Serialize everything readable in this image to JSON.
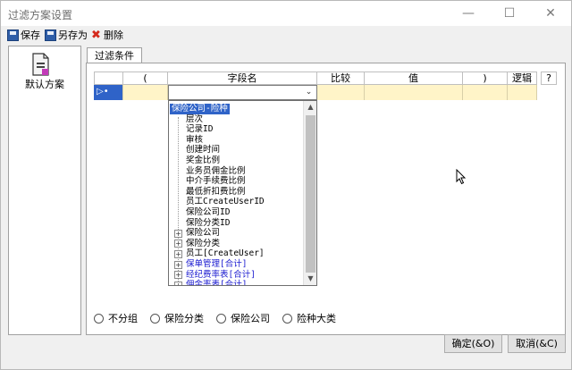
{
  "window": {
    "title": "过滤方案设置",
    "minimize_glyph": "—",
    "maximize_glyph": "☐",
    "close_glyph": "✕"
  },
  "toolbar": {
    "save_label": "保存",
    "saveas_label": "另存为",
    "delete_label": "删除",
    "save_icon": "save-icon",
    "saveas_icon": "save-as-icon",
    "delete_icon": "delete-x-icon"
  },
  "schemes": {
    "items": [
      {
        "label": "默认方案",
        "icon": "document-icon"
      }
    ]
  },
  "tab": {
    "label": "过滤条件"
  },
  "grid": {
    "columns": [
      "(",
      "字段名",
      "比较",
      "值",
      ")",
      "逻辑"
    ],
    "help_button": "?",
    "row_marker": "▷•"
  },
  "combo": {
    "value": "",
    "arrow": "⌄"
  },
  "dropdown": {
    "items": [
      {
        "label": "保险公司-险种",
        "selected": true,
        "expandable": false,
        "blue": false,
        "level": 0
      },
      {
        "label": "层次",
        "selected": false,
        "expandable": false,
        "blue": false,
        "level": 1
      },
      {
        "label": "记录ID",
        "selected": false,
        "expandable": false,
        "blue": false,
        "level": 1
      },
      {
        "label": "审核",
        "selected": false,
        "expandable": false,
        "blue": false,
        "level": 1
      },
      {
        "label": "创建时间",
        "selected": false,
        "expandable": false,
        "blue": false,
        "level": 1
      },
      {
        "label": "奖金比例",
        "selected": false,
        "expandable": false,
        "blue": false,
        "level": 1
      },
      {
        "label": "业务员佣金比例",
        "selected": false,
        "expandable": false,
        "blue": false,
        "level": 1
      },
      {
        "label": "中介手续费比例",
        "selected": false,
        "expandable": false,
        "blue": false,
        "level": 1
      },
      {
        "label": "最低折扣费比例",
        "selected": false,
        "expandable": false,
        "blue": false,
        "level": 1
      },
      {
        "label": "员工CreateUserID",
        "selected": false,
        "expandable": false,
        "blue": false,
        "level": 1
      },
      {
        "label": "保险公司ID",
        "selected": false,
        "expandable": false,
        "blue": false,
        "level": 1
      },
      {
        "label": "保险分类ID",
        "selected": false,
        "expandable": false,
        "blue": false,
        "level": 1
      },
      {
        "label": "保险公司",
        "selected": false,
        "expandable": true,
        "blue": false,
        "level": 1
      },
      {
        "label": "保险分类",
        "selected": false,
        "expandable": true,
        "blue": false,
        "level": 1
      },
      {
        "label": "员工[CreateUser]",
        "selected": false,
        "expandable": true,
        "blue": false,
        "level": 1
      },
      {
        "label": "保单管理[合计]",
        "selected": false,
        "expandable": true,
        "blue": true,
        "level": 1
      },
      {
        "label": "经纪费率表[合计]",
        "selected": false,
        "expandable": true,
        "blue": true,
        "level": 1
      },
      {
        "label": "佣金率表[合计]",
        "selected": false,
        "expandable": true,
        "blue": true,
        "level": 1
      }
    ],
    "scroll_up": "▲",
    "scroll_down": "▼"
  },
  "grouping": {
    "options": [
      "不分组",
      "保险分类",
      "保险公司",
      "险种大类"
    ]
  },
  "buttons": {
    "ok_label": "确定(&O)",
    "cancel_label": "取消(&C)"
  }
}
